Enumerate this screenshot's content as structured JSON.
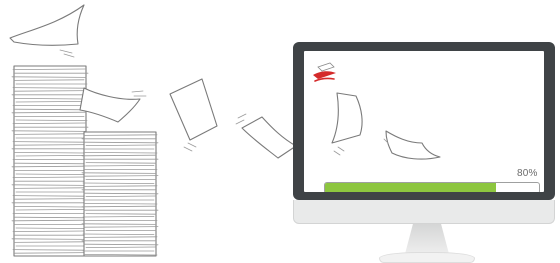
{
  "upload": {
    "progress_percent": 80,
    "progress_label": "80%",
    "bar_color": "#8dc63f",
    "logo_accent_color": "#d42a2a"
  },
  "icons": [
    "paper-stack-icon",
    "flying-paper-icon",
    "monitor-icon",
    "logo-icon"
  ]
}
